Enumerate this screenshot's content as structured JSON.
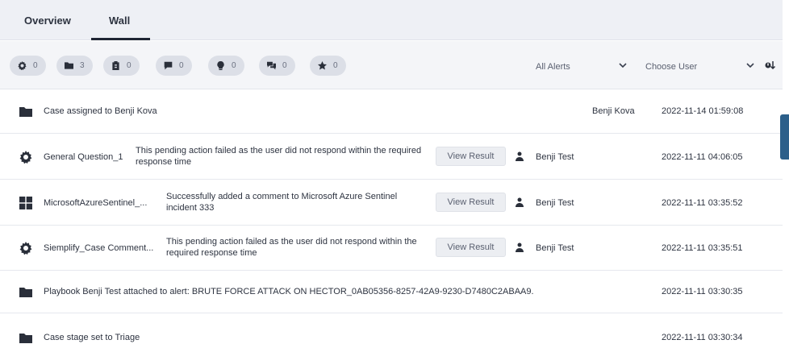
{
  "tabs": {
    "overview": "Overview",
    "wall": "Wall"
  },
  "filters": {
    "chips": [
      {
        "icon": "gear-icon",
        "count": "0"
      },
      {
        "icon": "folder-icon",
        "count": "3"
      },
      {
        "icon": "clipboard-icon",
        "count": "0"
      },
      {
        "icon": "comment-icon",
        "count": "0"
      },
      {
        "icon": "lightbulb-icon",
        "count": "0"
      },
      {
        "icon": "chat-bubbles-icon",
        "count": "0"
      },
      {
        "icon": "star-icon",
        "count": "0"
      }
    ],
    "alerts_select": "All Alerts",
    "user_select": "Choose User"
  },
  "rows": [
    {
      "icon": "folder-icon",
      "title": "Case assigned to Benji Kova",
      "user": "Benji Kova",
      "date": "2022-11-14 01:59:08"
    },
    {
      "icon": "gear-icon",
      "title": "General Question_1",
      "desc": "This pending action failed as the user did not respond within the required response time",
      "button": "View Result",
      "user": "Benji Test",
      "date": "2022-11-11 04:06:05"
    },
    {
      "icon": "windows-icon",
      "title": "MicrosoftAzureSentinel_...",
      "desc": "Successfully added a comment to Microsoft Azure Sentinel incident 333",
      "button": "View Result",
      "user": "Benji Test",
      "date": "2022-11-11 03:35:52"
    },
    {
      "icon": "gear-icon",
      "title": "Siemplify_Case Comment...",
      "desc": "This pending action failed as the user did not respond within the required response time",
      "button": "View Result",
      "user": "Benji Test",
      "date": "2022-11-11 03:35:51"
    },
    {
      "icon": "folder-icon",
      "title": "Playbook Benji Test attached to alert: BRUTE FORCE ATTACK ON HECTOR_0AB05356-8257-42A9-9230-D7480C2ABAA9.",
      "date": "2022-11-11 03:30:35"
    },
    {
      "icon": "folder-icon",
      "title": "Case stage set to Triage",
      "date": "2022-11-11 03:30:34"
    }
  ]
}
